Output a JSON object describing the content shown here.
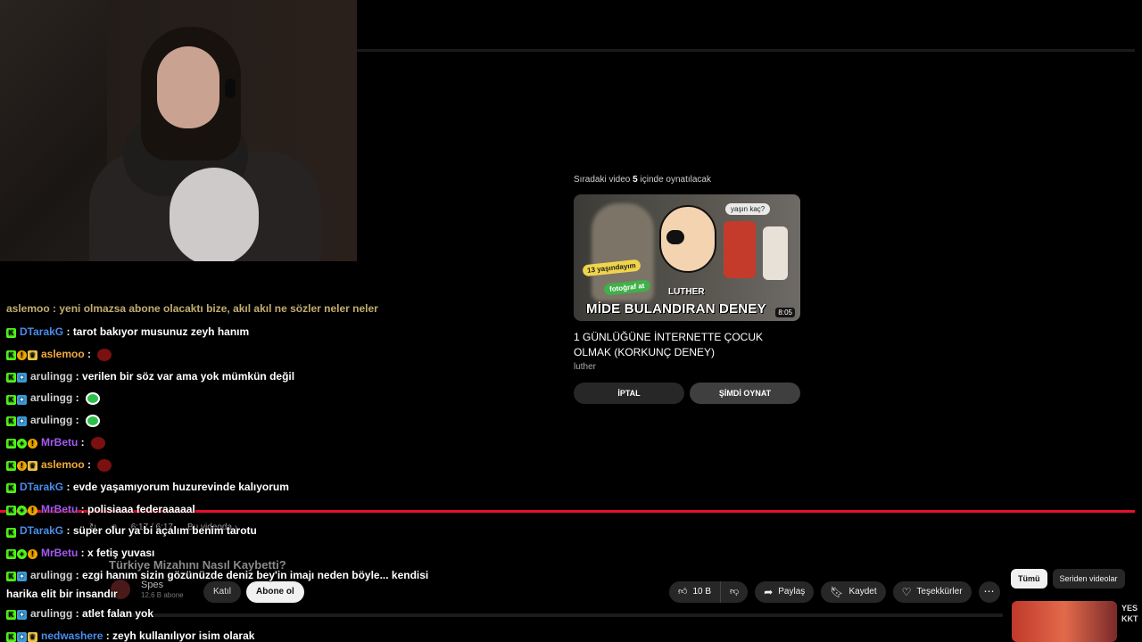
{
  "upnext": {
    "prefix": "Sıradaki video",
    "seconds": "5",
    "suffix": "içinde oynatılacak",
    "thumb_bubble": "yaşın kaç?",
    "thumb_tag1": "13 yaşındayım",
    "thumb_tag2": "fotoğraf at",
    "thumb_name": "LUTHER",
    "thumb_headline": "MİDE BULANDIRAN DENEY",
    "duration": "8:05",
    "title": "1 GÜNLÜĞÜNE İNTERNETTE ÇOCUK OLMAK (KORKUNÇ DENEY)",
    "channel": "luther",
    "cancel_label": "İPTAL",
    "play_label": "ŞİMDİ OYNAT"
  },
  "player": {
    "time": "6:17 / 6:17",
    "chapter": "Bu videoda"
  },
  "video": {
    "title": "Türkiye Mizahını Nasıl Kaybetti?",
    "channel_name": "Spes",
    "subscribers": "12,6 B abone",
    "join_label": "Katıl",
    "subscribe_label": "Abone ol",
    "likes": "10 B",
    "share_label": "Paylaş",
    "save_label": "Kaydet",
    "thanks_label": "Teşekkürler"
  },
  "filters": {
    "all": "Tümü",
    "series": "Seriden videolar"
  },
  "side": {
    "text1": "YES",
    "text2": "KKT"
  },
  "chat": {
    "cutoff_line": "aslemoo : yeni olmazsa abone olacaktı bize, akıl akıl ne sözler neler neler",
    "messages": [
      {
        "user": "DTarakG",
        "color": "#4a8dea",
        "badges": [
          "k"
        ],
        "text": "tarot bakıyor musunuz zeyh hanım"
      },
      {
        "user": "aslemoo",
        "color": "#f2a93b",
        "badges": [
          "k",
          "gift",
          "crown"
        ],
        "text": "",
        "emote": "red"
      },
      {
        "user": "arulingg",
        "color": "#cfcfcf",
        "badges": [
          "k",
          "sub"
        ],
        "text": "verilen bir söz var ama yok mümkün değil"
      },
      {
        "user": "arulingg",
        "color": "#cfcfcf",
        "badges": [
          "k",
          "sub"
        ],
        "text": "",
        "emote": "green"
      },
      {
        "user": "arulingg",
        "color": "#cfcfcf",
        "badges": [
          "k",
          "sub"
        ],
        "text": "",
        "emote": "green"
      },
      {
        "user": "MrBetu",
        "color": "#a25bf0",
        "badges": [
          "k",
          "plus",
          "gift"
        ],
        "text": "",
        "emote": "red"
      },
      {
        "user": "aslemoo",
        "color": "#f2a93b",
        "badges": [
          "k",
          "gift",
          "crown"
        ],
        "text": "",
        "emote": "red"
      },
      {
        "user": "DTarakG",
        "color": "#4a8dea",
        "badges": [
          "k"
        ],
        "text": "evde yaşamıyorum huzurevinde kalıyorum"
      },
      {
        "user": "MrBetu",
        "color": "#a25bf0",
        "badges": [
          "k",
          "plus",
          "gift"
        ],
        "text": "polisiaaa federaaaaal"
      },
      {
        "user": "DTarakG",
        "color": "#4a8dea",
        "badges": [
          "k"
        ],
        "text": "süper olur ya bi açalım benim tarotu"
      },
      {
        "user": "MrBetu",
        "color": "#a25bf0",
        "badges": [
          "k",
          "plus",
          "gift"
        ],
        "text": "x fetiş yuvası"
      },
      {
        "user": "arulingg",
        "color": "#cfcfcf",
        "badges": [
          "k",
          "sub"
        ],
        "text": "ezgi hanım sizin gözünüzde deniz bey'in imajı neden böyle... kendisi harika elit bir insandır",
        "wrap": true
      },
      {
        "user": "arulingg",
        "color": "#cfcfcf",
        "badges": [
          "k",
          "sub"
        ],
        "text": "atlet falan yok"
      },
      {
        "user": "nedwashere",
        "color": "#4a8dea",
        "badges": [
          "k",
          "sub",
          "crown"
        ],
        "text": "zeyh kullanılıyor isim olarak"
      }
    ]
  }
}
